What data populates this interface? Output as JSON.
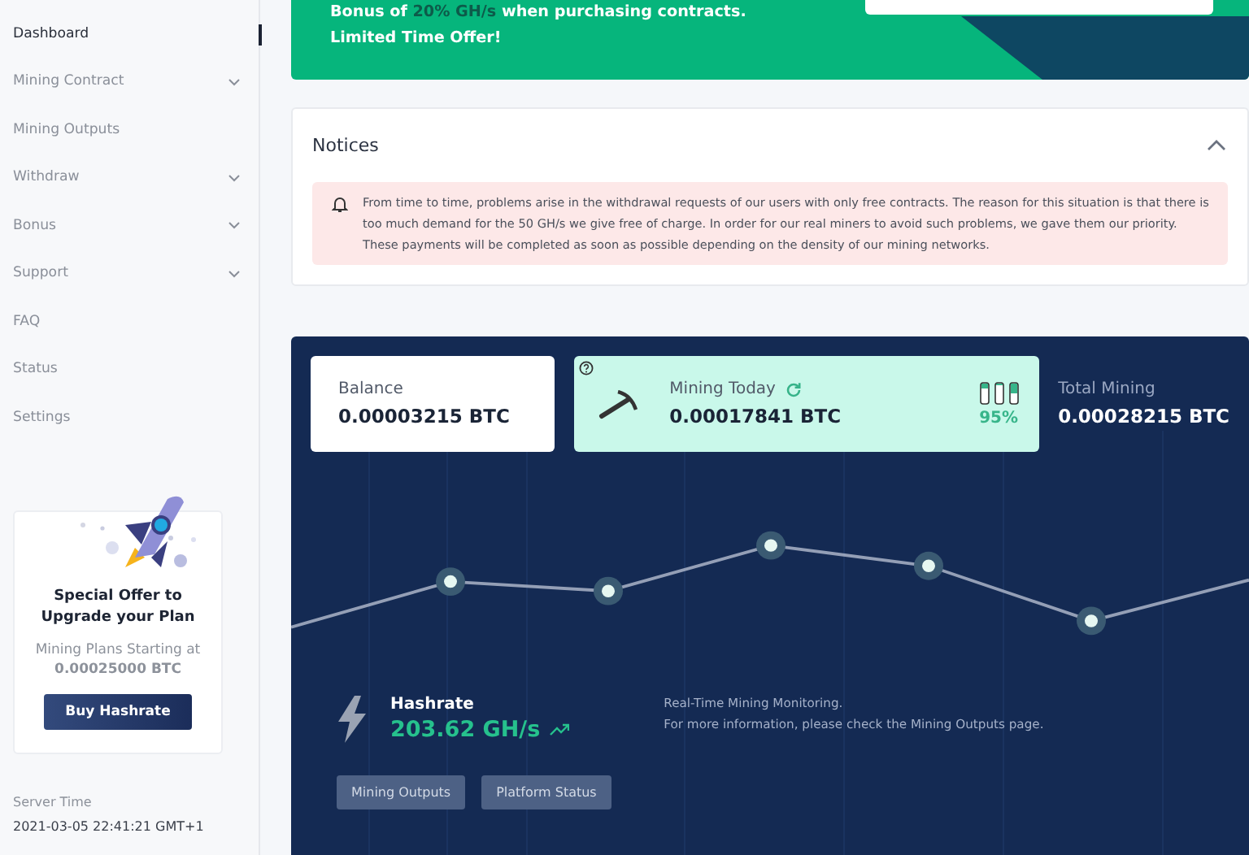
{
  "sidebar": {
    "items": [
      {
        "label": "Dashboard",
        "selected": true,
        "has_submenu": false
      },
      {
        "label": "Mining Contract",
        "selected": false,
        "has_submenu": true
      },
      {
        "label": "Mining Outputs",
        "selected": false,
        "has_submenu": false
      },
      {
        "label": "Withdraw",
        "selected": false,
        "has_submenu": true
      },
      {
        "label": "Bonus",
        "selected": false,
        "has_submenu": true
      },
      {
        "label": "Support",
        "selected": false,
        "has_submenu": true
      },
      {
        "label": "FAQ",
        "selected": false,
        "has_submenu": false
      },
      {
        "label": "Status",
        "selected": false,
        "has_submenu": false
      },
      {
        "label": "Settings",
        "selected": false,
        "has_submenu": false
      }
    ],
    "offer": {
      "title": "Special Offer to Upgrade your Plan",
      "text": "Mining Plans Starting at **0.00025000 BTC**",
      "button": "Buy Hashrate"
    },
    "server_time": {
      "label": "Server Time",
      "value": "2021-03-05 22:41:21 GMT+1"
    }
  },
  "banner": {
    "line_1": {
      "before": "Bonus of ",
      "highlight": "20% GH/s",
      "after": " when purchasing contracts."
    },
    "line_2": "Limited Time Offer!"
  },
  "notices": {
    "title": "Notices",
    "expanded": true,
    "message": "From time to time, problems arise in the withdrawal requests of our users with only free contracts. The reason for this situation is that there is too much demand for the 50 GH/s we give free of charge. In order for our real miners to avoid such problems, we gave them our priority. These payments will be completed as soon as possible depending on the density of our mining networks."
  },
  "mining": {
    "balance": {
      "label": "Balance",
      "value": "0.00003215 BTC"
    },
    "today": {
      "label": "Mining Today",
      "value": "0.00017841 BTC",
      "percent": "95%"
    },
    "total": {
      "label": "Total Mining",
      "value": "0.00028215 BTC"
    },
    "hashrate": {
      "label": "Hashrate",
      "value": "203.62 GH/s"
    },
    "info": [
      "Real-Time Mining Monitoring.",
      "For more information, please check the Mining Outputs page."
    ],
    "buttons": [
      "Mining Outputs",
      "Platform Status"
    ]
  }
}
